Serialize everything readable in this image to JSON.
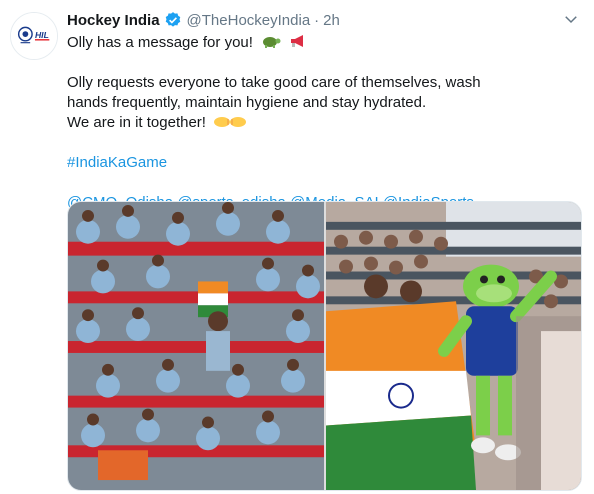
{
  "tweet": {
    "author_name": "Hockey India",
    "handle": "@TheHockeyIndia",
    "separator": "·",
    "time": "2h",
    "lines": [
      "Olly has a message for you!",
      "Olly requests everyone to take good care of themselves, wash",
      "hands frequently, maintain hygiene and stay hydrated.",
      "We are in it together!"
    ],
    "hashtag": "#IndiaKaGame",
    "mentions": "@CMO_Odisha @sports_odisha @Media_SAI @IndiaSports",
    "avatar_text": "HIL"
  },
  "icons": {
    "verified": "verified-badge-icon",
    "caret": "chevron-down-icon",
    "emoji_1": "turtle-emoji",
    "emoji_2": "megaphone-emoji",
    "emoji_3": "fist-bump-emoji"
  },
  "colors": {
    "link": "#1b95e0",
    "secondary_text": "#657786",
    "verified": "#1da1f2"
  }
}
